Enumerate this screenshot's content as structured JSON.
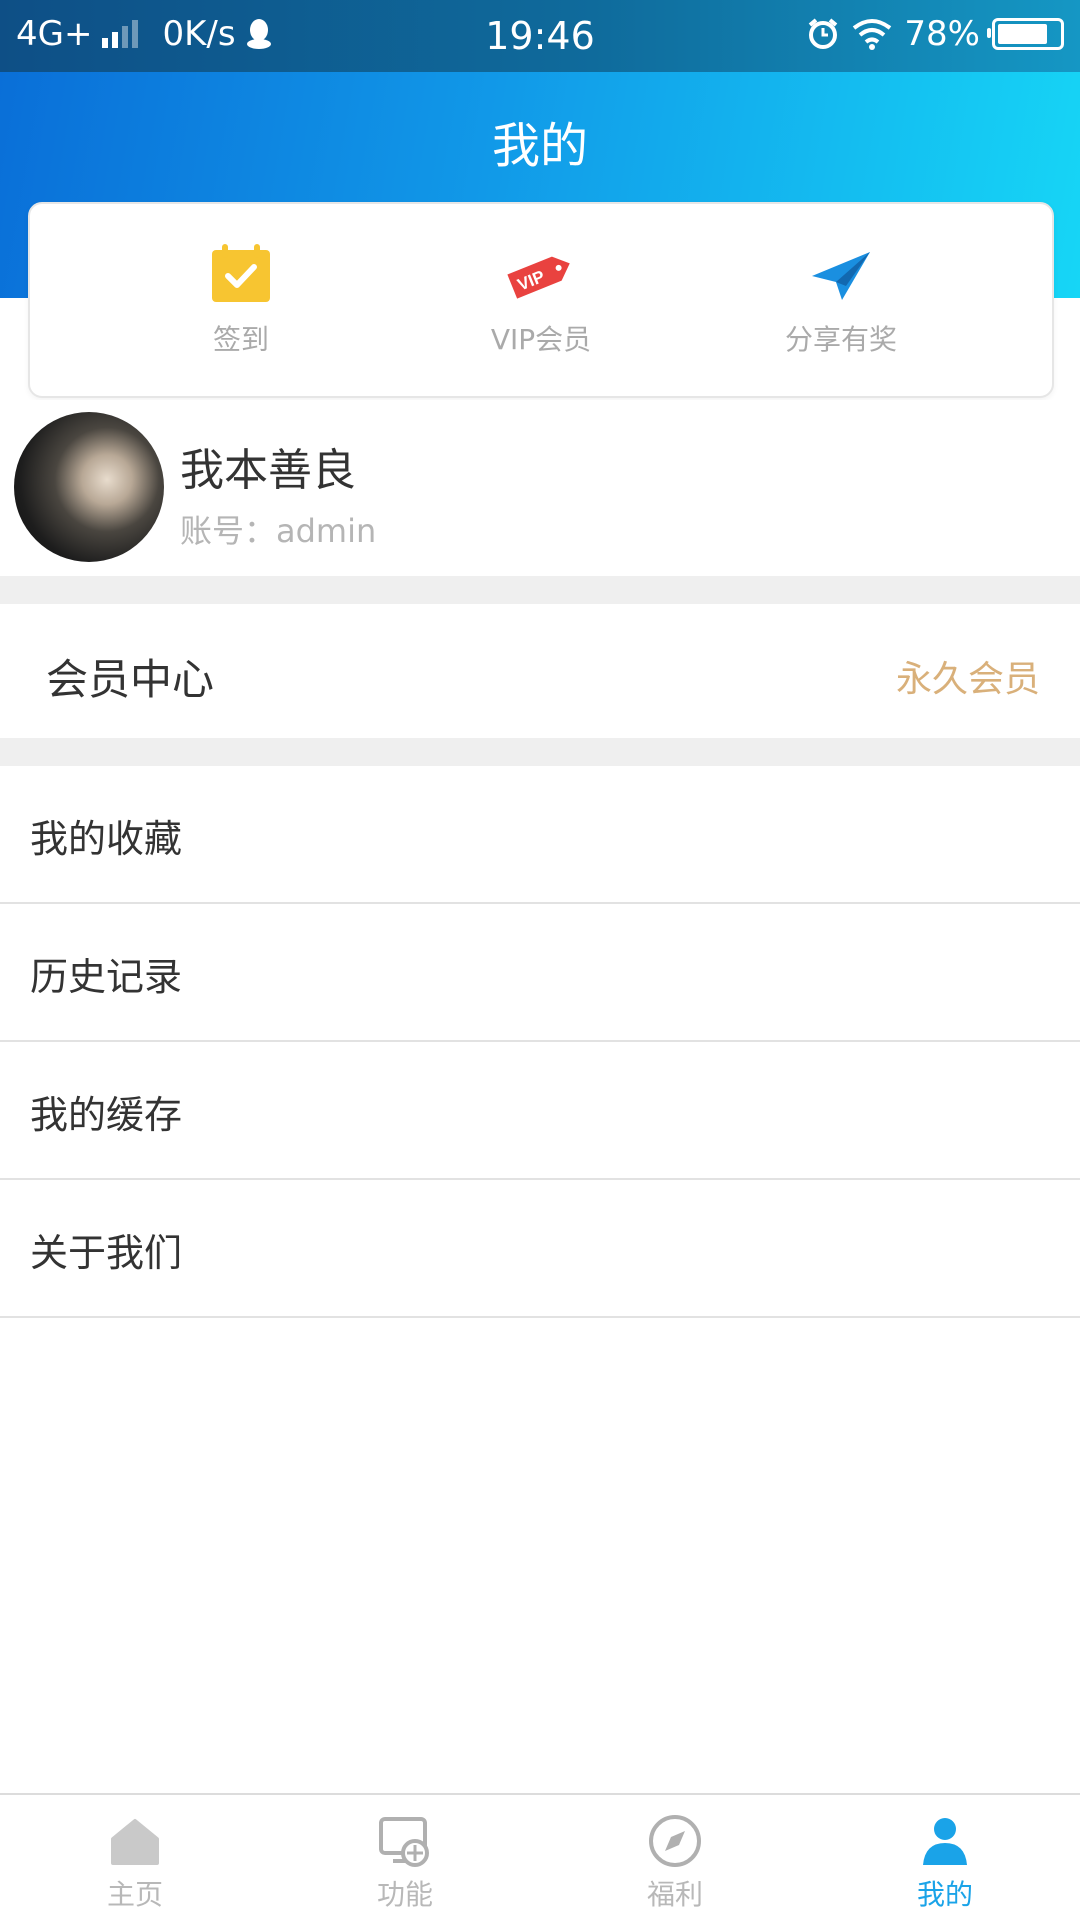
{
  "status_bar": {
    "network": "4G+",
    "speed": "0K/s",
    "time": "19:46",
    "battery": "78%"
  },
  "header": {
    "title": "我的"
  },
  "quick_actions": [
    {
      "label": "签到",
      "icon": "calendar-check-icon",
      "color": "#f7c531"
    },
    {
      "label": "VIP会员",
      "icon": "vip-tag-icon",
      "color": "#e9423f"
    },
    {
      "label": "分享有奖",
      "icon": "paper-plane-icon",
      "color": "#1a8fe0"
    }
  ],
  "profile": {
    "name": "我本善良",
    "account": "账号：admin"
  },
  "member_center": {
    "label": "会员中心",
    "status": "永久会员",
    "status_color": "#d9b07a"
  },
  "menu": [
    {
      "label": "我的收藏"
    },
    {
      "label": "历史记录"
    },
    {
      "label": "我的缓存"
    },
    {
      "label": "关于我们"
    }
  ],
  "bottom_nav": [
    {
      "label": "主页",
      "icon": "home-icon",
      "active": false
    },
    {
      "label": "功能",
      "icon": "function-icon",
      "active": false
    },
    {
      "label": "福利",
      "icon": "compass-icon",
      "active": false
    },
    {
      "label": "我的",
      "icon": "user-icon",
      "active": true
    }
  ],
  "colors": {
    "accent": "#1aa3e8",
    "header_start": "#0a6fd8",
    "header_end": "#16d6f6"
  }
}
